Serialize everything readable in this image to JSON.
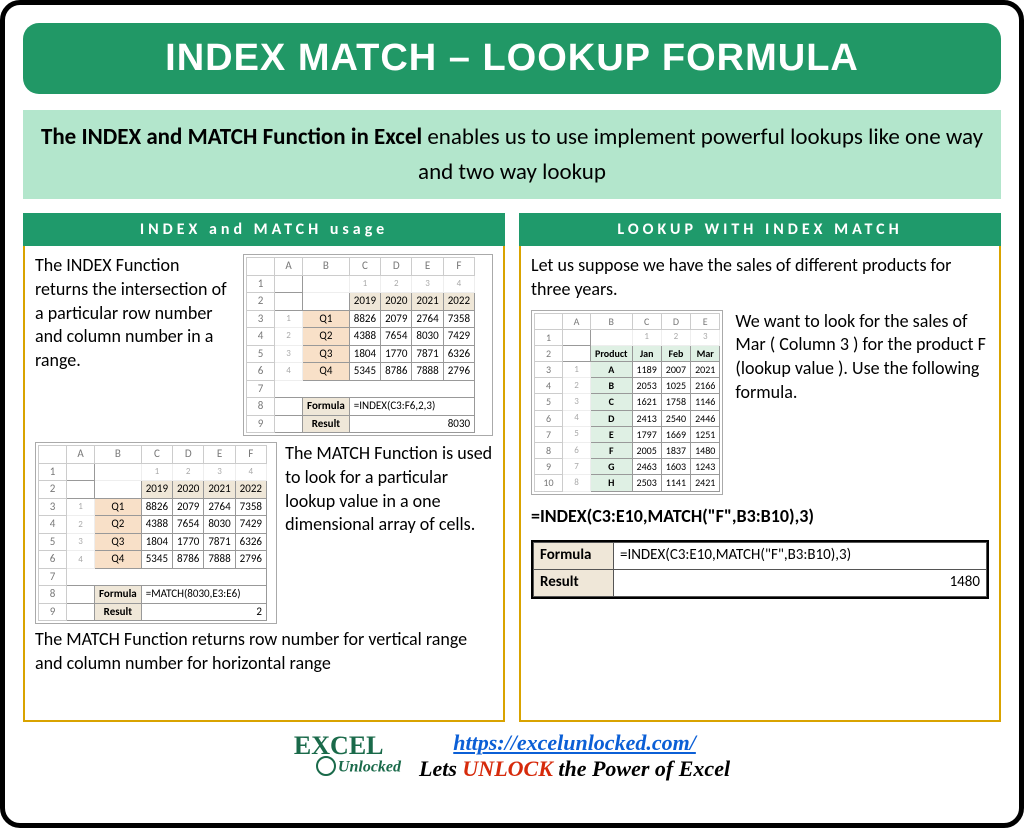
{
  "title": "INDEX MATCH – LOOKUP FORMULA",
  "subtitle_bold": "The INDEX and MATCH Function in Excel",
  "subtitle_rest": " enables us to use implement powerful lookups like one way and two way lookup",
  "left": {
    "heading": "INDEX and MATCH usage",
    "index_desc": "The INDEX Function returns the intersection of a particular row number and column number in a range.",
    "match_desc": "The MATCH Function is used to look for a particular lookup value in a one dimensional array of cells.",
    "match_note": "The MATCH Function returns row number for vertical range and column number for horizontal range",
    "index_table": {
      "cols": [
        "A",
        "B",
        "C",
        "D",
        "E",
        "F"
      ],
      "numrow": [
        "",
        "1",
        "2",
        "3",
        "4"
      ],
      "years": [
        "2019",
        "2020",
        "2021",
        "2022"
      ],
      "rows": [
        {
          "n": "1",
          "q": "Q1",
          "v": [
            "8826",
            "2079",
            "2764",
            "7358"
          ]
        },
        {
          "n": "2",
          "q": "Q2",
          "v": [
            "4388",
            "7654",
            "8030",
            "7429"
          ]
        },
        {
          "n": "3",
          "q": "Q3",
          "v": [
            "1804",
            "1770",
            "7871",
            "6326"
          ]
        },
        {
          "n": "4",
          "q": "Q4",
          "v": [
            "5345",
            "8786",
            "7888",
            "2796"
          ]
        }
      ],
      "formula_label": "Formula",
      "formula_val": "=INDEX(C3:F6,2,3)",
      "result_label": "Result",
      "result_val": "8030"
    },
    "match_table": {
      "cols": [
        "A",
        "B",
        "C",
        "D",
        "E",
        "F"
      ],
      "numrow": [
        "",
        "1",
        "2",
        "3",
        "4"
      ],
      "years": [
        "2019",
        "2020",
        "2021",
        "2022"
      ],
      "rows": [
        {
          "n": "1",
          "q": "Q1",
          "v": [
            "8826",
            "2079",
            "2764",
            "7358"
          ]
        },
        {
          "n": "2",
          "q": "Q2",
          "v": [
            "4388",
            "7654",
            "8030",
            "7429"
          ]
        },
        {
          "n": "3",
          "q": "Q3",
          "v": [
            "1804",
            "1770",
            "7871",
            "6326"
          ]
        },
        {
          "n": "4",
          "q": "Q4",
          "v": [
            "5345",
            "8786",
            "7888",
            "2796"
          ]
        }
      ],
      "formula_label": "Formula",
      "formula_val": "=MATCH(8030,E3:E6)",
      "result_label": "Result",
      "result_val": "2"
    }
  },
  "right": {
    "heading": "LOOKUP WITH INDEX MATCH",
    "intro": "Let us suppose we have the sales of different products for three years.",
    "want": "We want to look for the sales of Mar ( Column 3 ) for the product F (lookup value ). Use the following formula.",
    "products_table": {
      "cols": [
        "A",
        "B",
        "C",
        "D",
        "E"
      ],
      "headers": [
        "Product",
        "Jan",
        "Feb",
        "Mar"
      ],
      "numrow": [
        "1",
        "2",
        "3",
        "4",
        "5",
        "6",
        "7",
        "8"
      ],
      "rows": [
        {
          "p": "A",
          "v": [
            "1189",
            "2007",
            "2021"
          ]
        },
        {
          "p": "B",
          "v": [
            "2053",
            "1025",
            "2166"
          ]
        },
        {
          "p": "C",
          "v": [
            "1621",
            "1758",
            "1146"
          ]
        },
        {
          "p": "D",
          "v": [
            "2413",
            "2540",
            "2446"
          ]
        },
        {
          "p": "E",
          "v": [
            "1797",
            "1669",
            "1251"
          ]
        },
        {
          "p": "F",
          "v": [
            "2005",
            "1837",
            "1480"
          ]
        },
        {
          "p": "G",
          "v": [
            "2463",
            "1603",
            "1243"
          ]
        },
        {
          "p": "H",
          "v": [
            "2503",
            "1141",
            "2421"
          ]
        }
      ]
    },
    "formula": "=INDEX(C3:E10,MATCH(\"F\",B3:B10),3)",
    "result_box": {
      "formula_label": "Formula",
      "formula_val": "=INDEX(C3:E10,MATCH(\"F\",B3:B10),3)",
      "result_label": "Result",
      "result_val": "1480"
    }
  },
  "footer": {
    "logo_top": "EXCEL",
    "logo_bottom": "Unlocked",
    "url": "https://excelunlocked.com/",
    "slogan_pre": "Lets ",
    "slogan_unlock": "UNLOCK",
    "slogan_post": " the Power of Excel"
  }
}
